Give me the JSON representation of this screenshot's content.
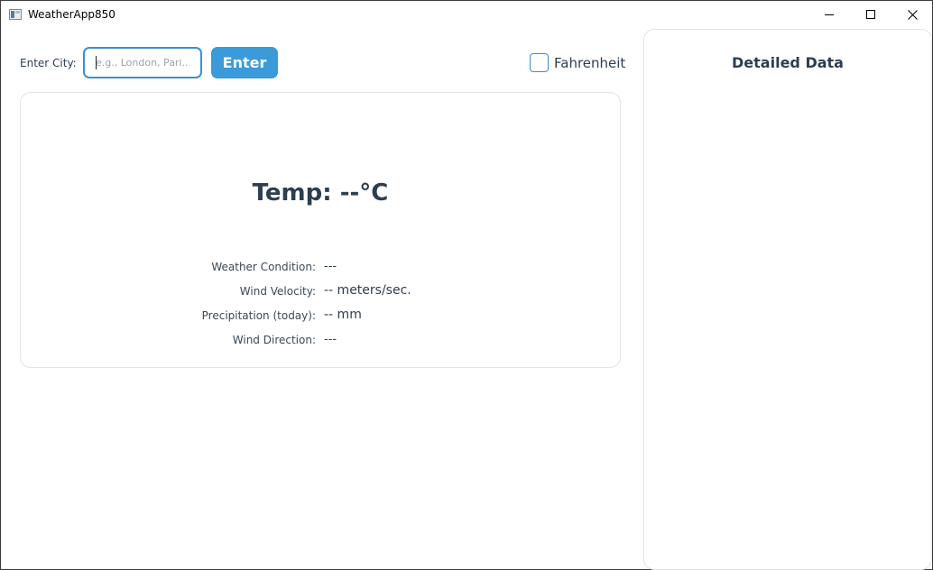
{
  "window": {
    "title": "WeatherApp850"
  },
  "controls": {
    "city_label": "Enter City:",
    "city_input_placeholder": "e.g., London, Pari...",
    "city_input_value": "",
    "enter_button": "Enter",
    "fahrenheit_label": "Fahrenheit",
    "fahrenheit_checked": false
  },
  "weather": {
    "temperature": "Temp: --°C",
    "details": [
      {
        "label": "Weather Condition:",
        "value": "---"
      },
      {
        "label": "Wind Velocity:",
        "value": "-- meters/sec."
      },
      {
        "label": "Precipitation (today):",
        "value": "-- mm"
      },
      {
        "label": "Wind Direction:",
        "value": "---"
      }
    ]
  },
  "side_panel": {
    "title": "Detailed Data"
  },
  "colors": {
    "accent": "#3b9ad9",
    "text": "#2c3e50",
    "card_border": "#dfe4e8"
  }
}
